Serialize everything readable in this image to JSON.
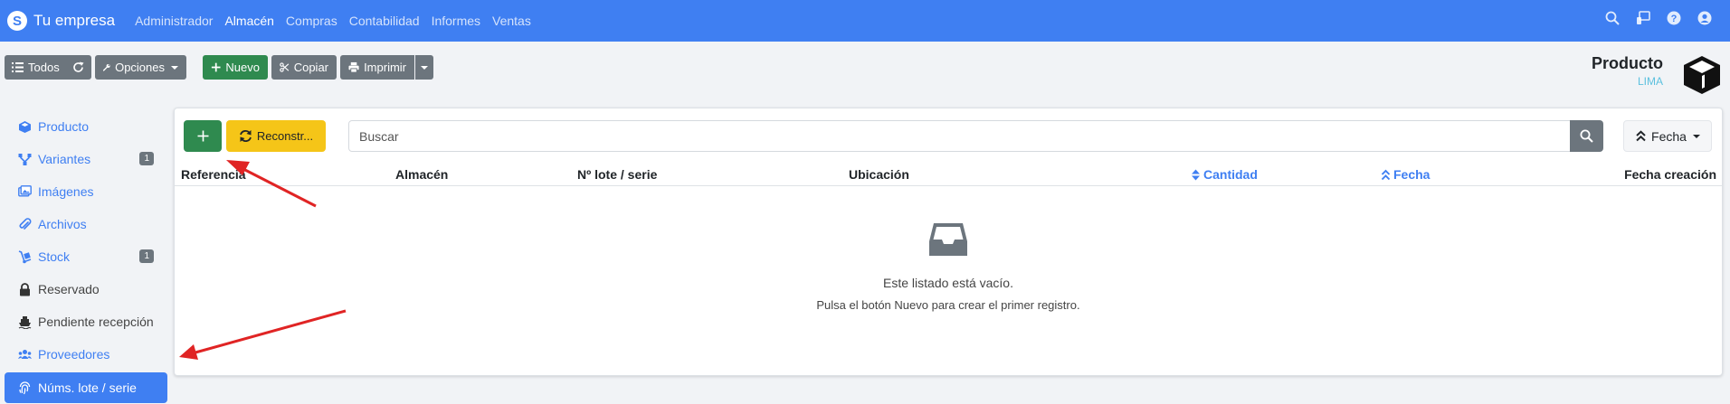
{
  "navbar": {
    "brand": "Tu empresa",
    "links": [
      {
        "label": "Administrador",
        "active": false
      },
      {
        "label": "Almacén",
        "active": true
      },
      {
        "label": "Compras",
        "active": false
      },
      {
        "label": "Contabilidad",
        "active": false
      },
      {
        "label": "Informes",
        "active": false
      },
      {
        "label": "Ventas",
        "active": false
      }
    ],
    "icons": [
      "search-icon",
      "monitor-icon",
      "help-icon",
      "user-icon"
    ]
  },
  "toolbar": {
    "all_label": "Todos",
    "options_label": "Opciones",
    "new_label": "Nuevo",
    "copy_label": "Copiar",
    "print_label": "Imprimir"
  },
  "header": {
    "title": "Producto",
    "subtitle": "LIMA"
  },
  "sidebar": {
    "items": [
      {
        "label": "Producto",
        "icon": "cube-icon"
      },
      {
        "label": "Variantes",
        "icon": "sitemap-icon",
        "badge": "1"
      },
      {
        "label": "Imágenes",
        "icon": "images-icon"
      },
      {
        "label": "Archivos",
        "icon": "paperclip-icon"
      },
      {
        "label": "Stock",
        "icon": "dolly-icon",
        "badge": "1"
      },
      {
        "label": "Reservado",
        "icon": "lock-icon"
      },
      {
        "label": "Pendiente recepción",
        "icon": "ship-icon"
      },
      {
        "label": "Proveedores",
        "icon": "users-icon"
      },
      {
        "label": "Núms. lote / serie",
        "icon": "fingerprint-icon"
      }
    ]
  },
  "list": {
    "rebuild_label": "Reconstr...",
    "search_placeholder": "Buscar",
    "sort_label": "Fecha",
    "columns": [
      "Referencia",
      "Almacén",
      "Nº lote / serie",
      "Ubicación",
      "Cantidad",
      "Fecha",
      "Fecha creación"
    ],
    "empty_title": "Este listado está vacío.",
    "empty_hint": "Pulsa el botón Nuevo para crear el primer registro."
  },
  "colors": {
    "primary": "#3f7ff2",
    "success": "#2f8a4f",
    "warning": "#f5c518",
    "secondary": "#6c757d",
    "annotation_arrow": "#e02424"
  }
}
